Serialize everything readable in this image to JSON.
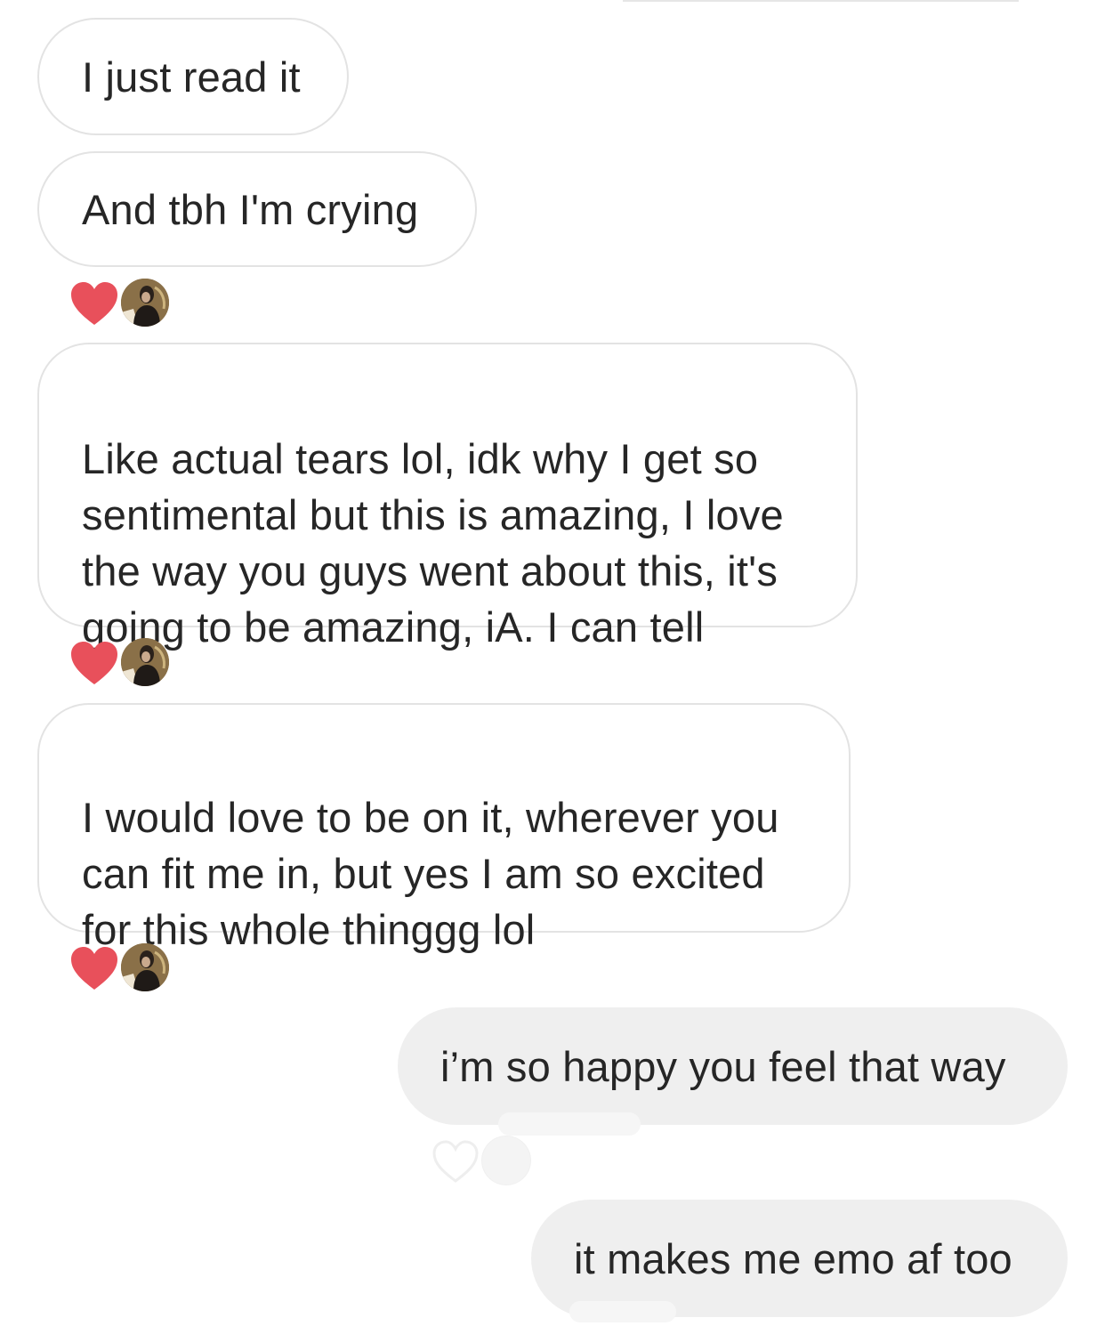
{
  "messages": [
    {
      "from": "them",
      "text": "I just read it"
    },
    {
      "from": "them",
      "text": "And tbh I'm crying"
    },
    {
      "from": "them",
      "text": "Like actual tears lol, idk why I get so\nsentimental but this is amazing, I love\nthe way you guys went about this, it's\ngoing to be amazing, iA. I can tell"
    },
    {
      "from": "them",
      "text": "I would love to be on it, wherever you\ncan fit me in, but yes I am so excited\nfor this whole thinggg lol"
    },
    {
      "from": "me",
      "text": "i’m so happy you feel that way"
    },
    {
      "from": "me",
      "text": "it makes me emo af too"
    }
  ],
  "reactions": [
    {
      "icon": "heart-icon",
      "color": "#e8505b",
      "reacted": true
    },
    {
      "icon": "heart-icon",
      "color": "#e8505b",
      "reacted": true
    },
    {
      "icon": "heart-icon",
      "color": "#e8505b",
      "reacted": true
    },
    {
      "icon": "heart-outline-icon",
      "color": "#eeeeee",
      "reacted": false
    }
  ],
  "colors": {
    "received_bubble_border": "#e3e3e3",
    "sent_bubble_bg": "#efefef",
    "text": "#262626",
    "heart": "#e8505b"
  }
}
